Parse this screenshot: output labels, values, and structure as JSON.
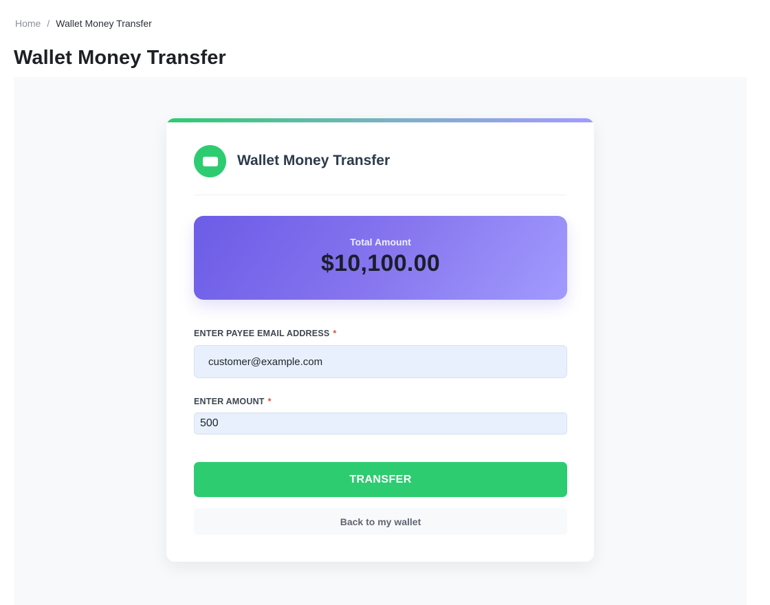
{
  "breadcrumb": {
    "home": "Home",
    "separator": "/",
    "current": "Wallet Money Transfer"
  },
  "page": {
    "title": "Wallet Money Transfer"
  },
  "card": {
    "title": "Wallet Money Transfer",
    "icon": "wallet-icon",
    "total": {
      "label": "Total Amount",
      "value": "$10,100.00"
    },
    "email_field": {
      "label": "ENTER PAYEE EMAIL ADDRESS",
      "required_mark": "*",
      "value": "customer@example.com"
    },
    "amount_field": {
      "label": "ENTER AMOUNT",
      "required_mark": "*",
      "value": "500"
    },
    "transfer_button": "TRANSFER",
    "back_button": "Back to my wallet"
  },
  "colors": {
    "accent_green": "#2ecc71",
    "gradient_purple_start": "#6c5ce7",
    "gradient_purple_end": "#a29bfe",
    "required_red": "#e74c3c",
    "input_bg": "#e8f0fe"
  }
}
